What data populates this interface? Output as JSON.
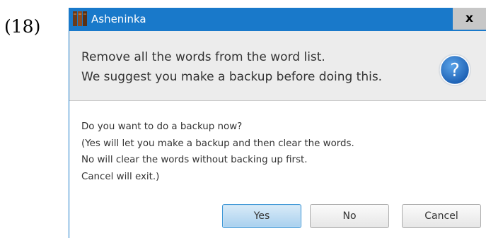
{
  "figure_label": "(18)",
  "window": {
    "title": "Asheninka",
    "close_label": "x"
  },
  "header": {
    "line1": "Remove all the words from the word list.",
    "line2": "We suggest you make a backup before doing this.",
    "icon": "question-icon"
  },
  "content": {
    "lines": [
      "Do you want to do a backup now?",
      "(Yes will let you make a backup and then clear the words.",
      "No will clear the words without backing up first.",
      "Cancel will exit.)"
    ]
  },
  "buttons": {
    "yes": "Yes",
    "no": "No",
    "cancel": "Cancel"
  },
  "colors": {
    "title_bar": "#1979ca",
    "header_panel": "#ececec",
    "default_button_border": "#3e97d6",
    "question_icon": "#2c74c6"
  }
}
